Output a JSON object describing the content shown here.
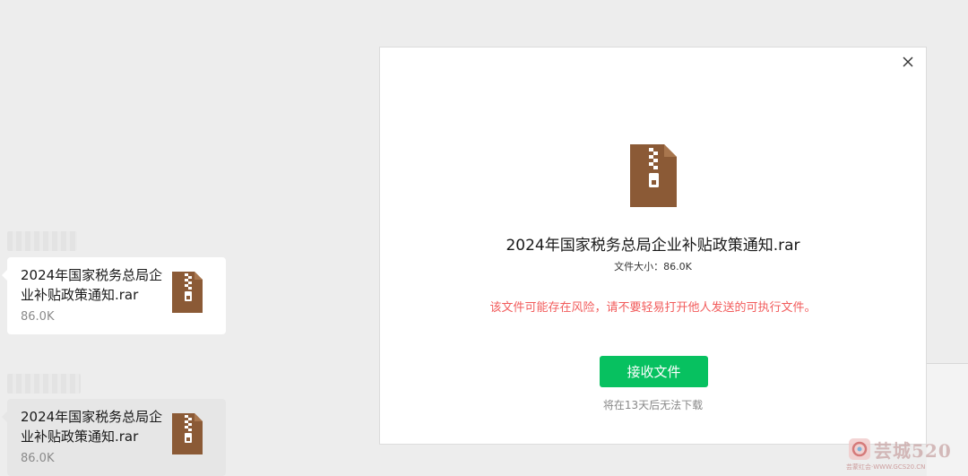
{
  "messages": [
    {
      "file_name": "2024年国家税务总局企业补贴政策通知.rar",
      "file_size": "86.0K"
    },
    {
      "file_name": "2024年国家税务总局企业补贴政策通知.rar",
      "file_size": "86.0K"
    }
  ],
  "dialog": {
    "file_name": "2024年国家税务总局企业补贴政策通知.rar",
    "file_size_text": "文件大小：86.0K",
    "warning": "该文件可能存在风险，请不要轻易打开他人发送的可执行文件。",
    "receive_button": "接收文件",
    "expire_note": "将在13天后无法下载",
    "close_icon": "close-icon",
    "file_icon": "zip-archive-icon"
  },
  "watermark": {
    "text": "芸城520",
    "url": "芸蒙红会·WWW.GCS20.CN"
  },
  "colors": {
    "accent_green": "#07c160",
    "warning_red": "#f25c5c",
    "archive_brown": "#8b5a36",
    "background": "#ededed"
  }
}
